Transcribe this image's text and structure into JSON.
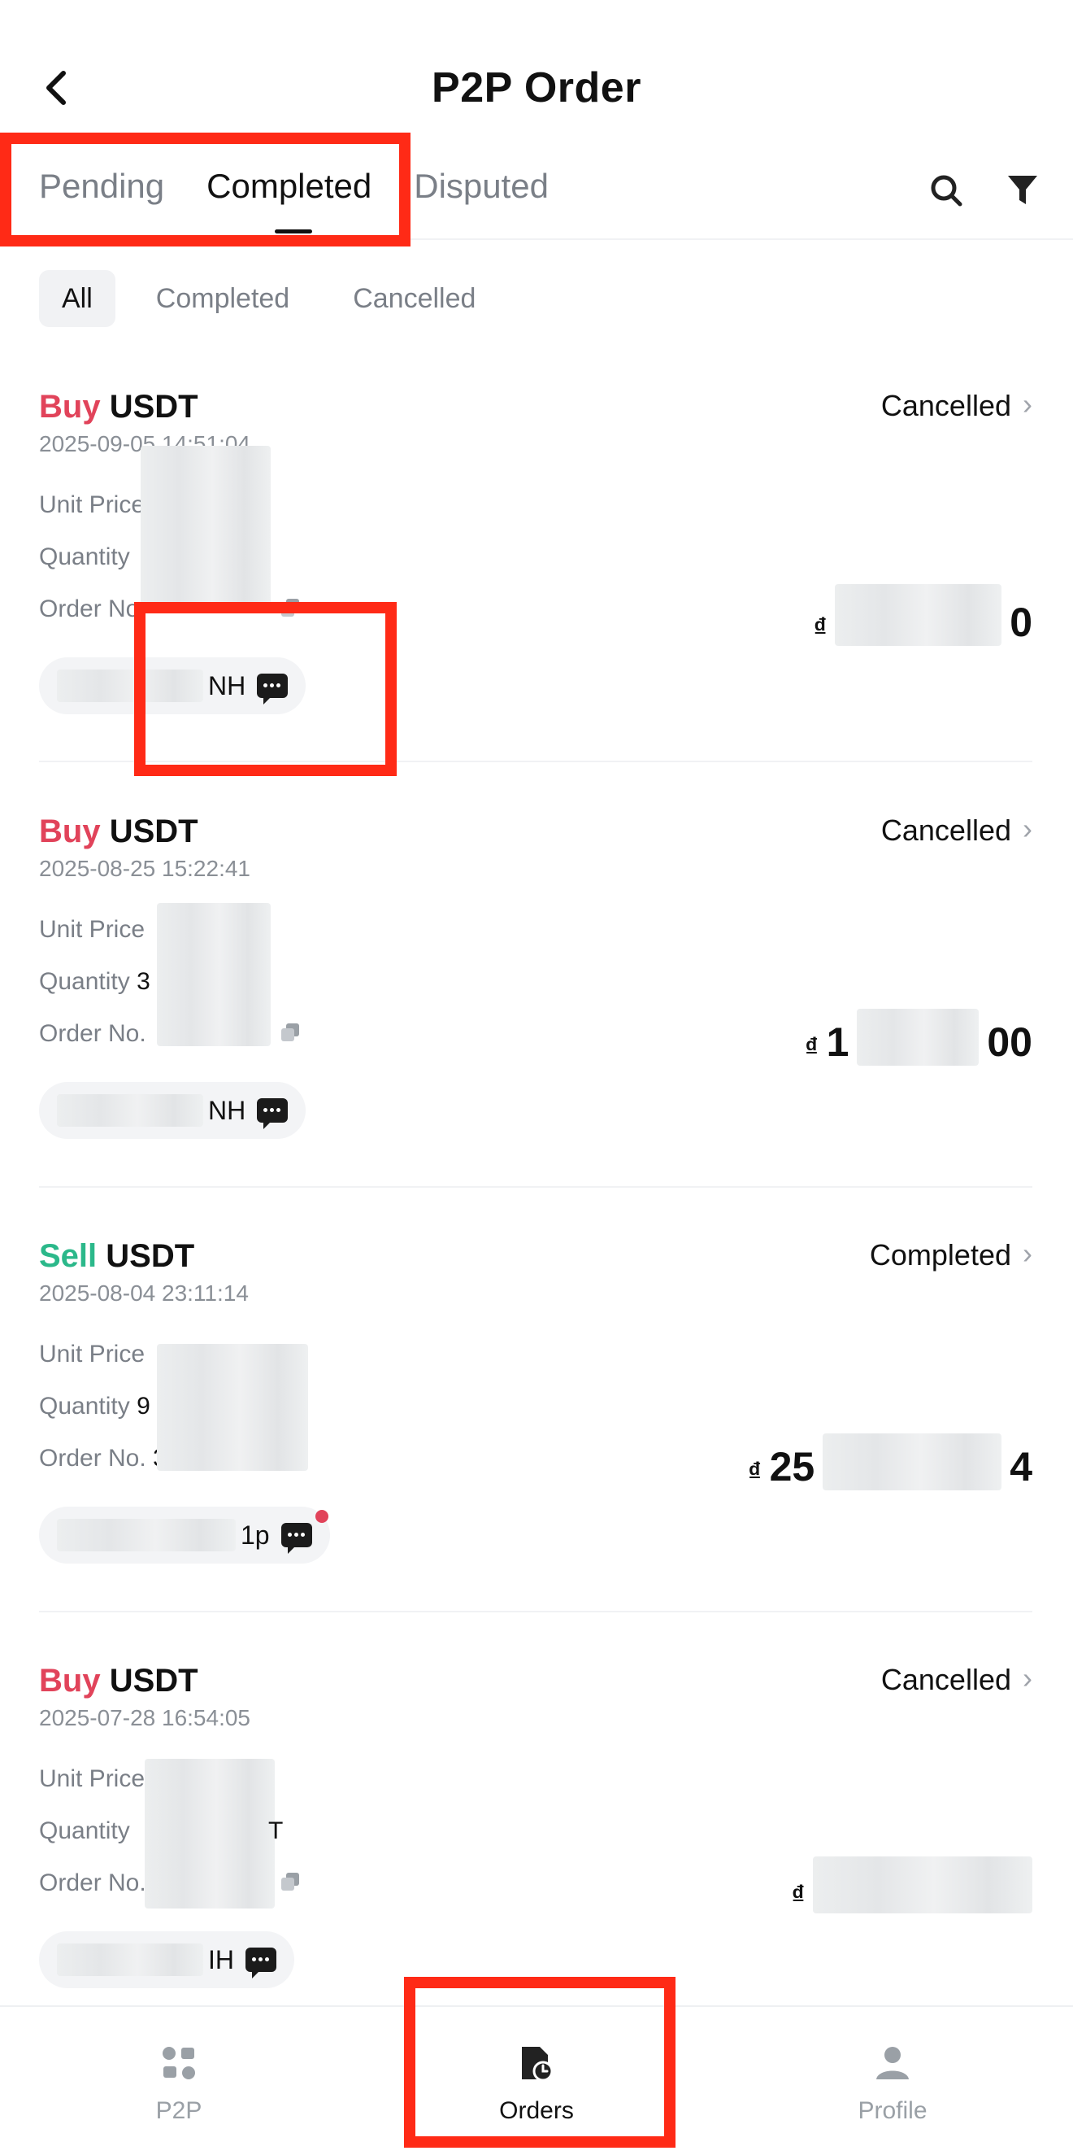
{
  "header": {
    "title": "P2P Order"
  },
  "tabs": [
    {
      "label": "Pending",
      "active": false
    },
    {
      "label": "Completed",
      "active": true
    },
    {
      "label": "Disputed",
      "active": false
    }
  ],
  "sub_filters": [
    {
      "label": "All",
      "active": true
    },
    {
      "label": "Completed",
      "active": false
    },
    {
      "label": "Cancelled",
      "active": false
    }
  ],
  "fields": {
    "unit_price": "Unit Price",
    "quantity": "Quantity",
    "order_no": "Order No."
  },
  "orders": [
    {
      "side": "Buy",
      "asset": "USDT",
      "time": "2025-09-05 14:51:04",
      "status": "Cancelled",
      "currency": "₫",
      "amount_visible": "0",
      "qty_visible": "",
      "order_visible": "",
      "merchant_visible": "NH"
    },
    {
      "side": "Buy",
      "asset": "USDT",
      "time": "2025-08-25 15:22:41",
      "status": "Cancelled",
      "currency": "₫",
      "amount_prefix": "1",
      "amount_suffix": "00",
      "qty_visible": "3",
      "order_visible": "",
      "merchant_visible": "NH"
    },
    {
      "side": "Sell",
      "asset": "USDT",
      "time": "2025-08-04 23:11:14",
      "status": "Completed",
      "currency": "₫",
      "amount_prefix": "25",
      "amount_suffix": "4",
      "qty_visible": "9",
      "order_visible": "3",
      "merchant_visible": "1p",
      "unread": true
    },
    {
      "side": "Buy",
      "asset": "USDT",
      "time": "2025-07-28 16:54:05",
      "status": "Cancelled",
      "currency": "₫",
      "qty_visible": "T",
      "merchant_visible": "IH"
    }
  ],
  "bottom_nav": [
    {
      "label": "P2P",
      "icon": "p2p-icon",
      "active": false
    },
    {
      "label": "Orders",
      "icon": "orders-icon",
      "active": true
    },
    {
      "label": "Profile",
      "icon": "profile-icon",
      "active": false
    }
  ],
  "colors": {
    "buy": "#e1435a",
    "sell": "#2bb88a",
    "annotation": "#ff2a16"
  }
}
